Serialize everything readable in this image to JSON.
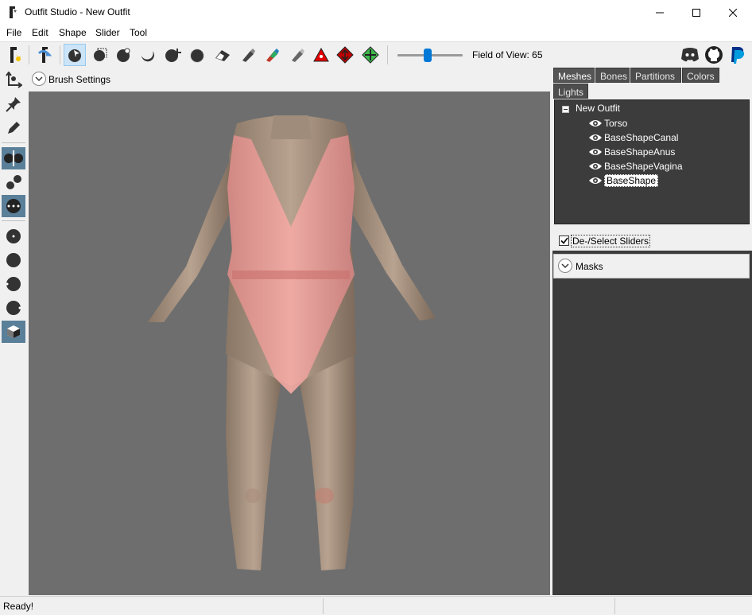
{
  "window": {
    "title": "Outfit Studio - New Outfit",
    "minimize_icon": "minimize-icon",
    "maximize_icon": "maximize-icon",
    "close_icon": "close-icon"
  },
  "menu": {
    "items": [
      "File",
      "Edit",
      "Shape",
      "Slider",
      "Tool"
    ]
  },
  "toolbar": {
    "field_of_view_label": "Field of View: 65",
    "field_of_view_value": 65,
    "icons": [
      "new-project-icon",
      "load-ref-icon",
      "select-brush-icon",
      "mask-brush-icon",
      "inflate-brush-icon",
      "deflate-brush-icon",
      "move-brush-icon",
      "smooth-brush-icon",
      "undiff-brush-icon",
      "weight-brush-icon",
      "color-brush-icon",
      "alpha-brush-icon",
      "collapse-vertex-icon",
      "flip-edge-icon",
      "split-edge-icon",
      "discord-icon",
      "github-icon",
      "paypal-icon"
    ]
  },
  "viewport": {
    "brush_settings_label": "Brush Settings"
  },
  "panel": {
    "tabs": [
      "Meshes",
      "Bones",
      "Partitions",
      "Colors",
      "Lights"
    ],
    "tree": {
      "root": "New Outfit",
      "items": [
        "Torso",
        "BaseShapeCanal",
        "BaseShapeAnus",
        "BaseShapeVagina",
        "BaseShape"
      ],
      "selected": "BaseShape"
    },
    "deselect_sliders": "De-/Select Sliders",
    "masks_label": "Masks"
  },
  "status": {
    "text": "Ready!"
  },
  "colors": {
    "viewport_bg": "#6e6e6e",
    "panel_dark": "#3c3c3c",
    "selected_tool": "#5a7f99",
    "accent": "#0078d7"
  }
}
